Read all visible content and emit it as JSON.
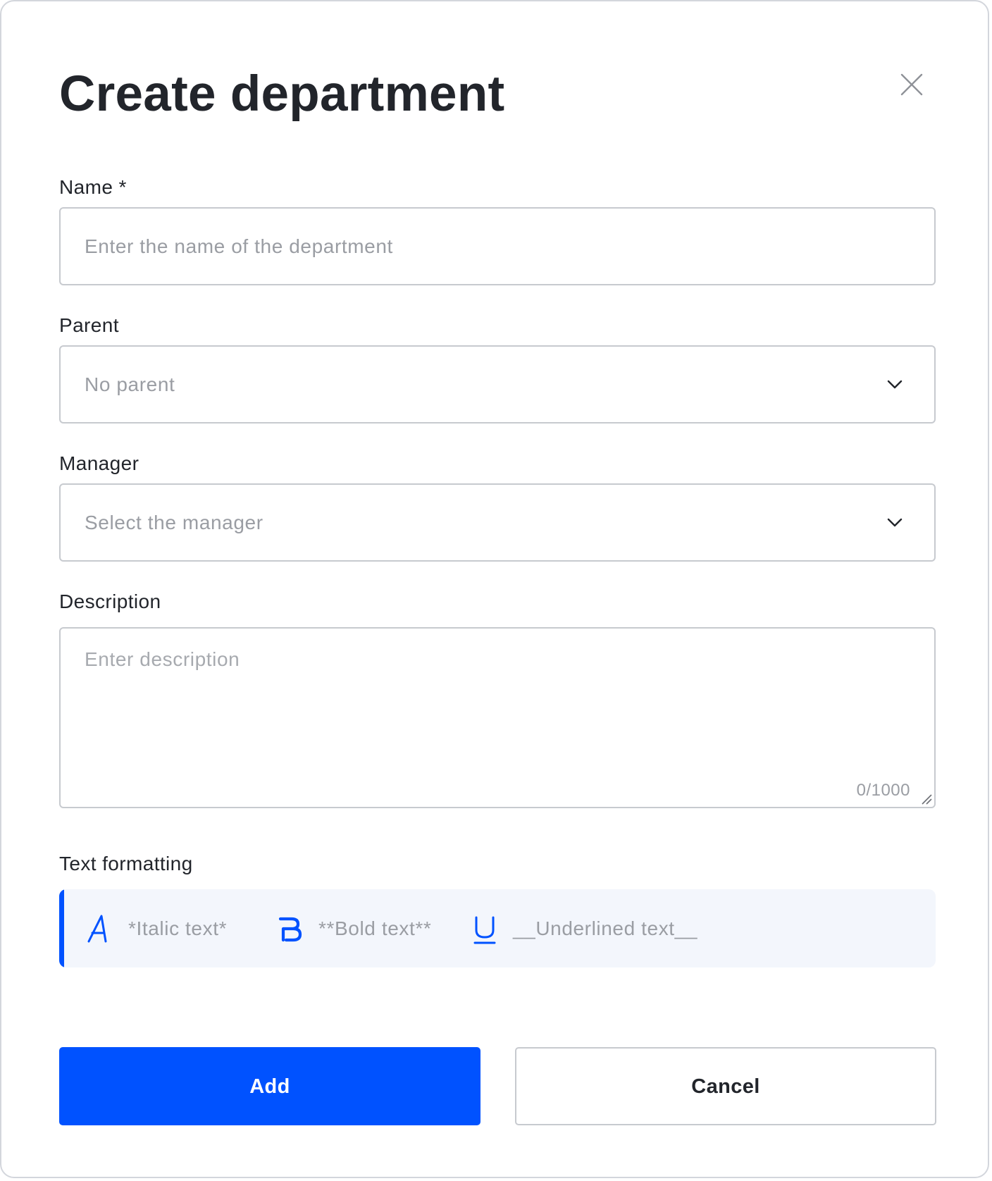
{
  "dialog": {
    "title": "Create department",
    "close_icon": "close-icon"
  },
  "form": {
    "name": {
      "label": "Name *",
      "value": "",
      "placeholder": "Enter the name of the department"
    },
    "parent": {
      "label": "Parent",
      "selected": "No parent",
      "icon": "chevron-down-icon"
    },
    "manager": {
      "label": "Manager",
      "placeholder": "Select the manager",
      "icon": "chevron-down-icon"
    },
    "description": {
      "label": "Description",
      "value": "",
      "placeholder": "Enter description",
      "counter": "0/1000"
    }
  },
  "formatting": {
    "label": "Text formatting",
    "accent_color": "#0052FF",
    "items": [
      {
        "icon": "italic-icon",
        "example": "*Italic text*"
      },
      {
        "icon": "bold-icon",
        "example": "**Bold text**"
      },
      {
        "icon": "underline-icon",
        "example": "__Underlined text__"
      }
    ]
  },
  "actions": {
    "add_label": "Add",
    "cancel_label": "Cancel",
    "primary_color": "#0052FF"
  }
}
